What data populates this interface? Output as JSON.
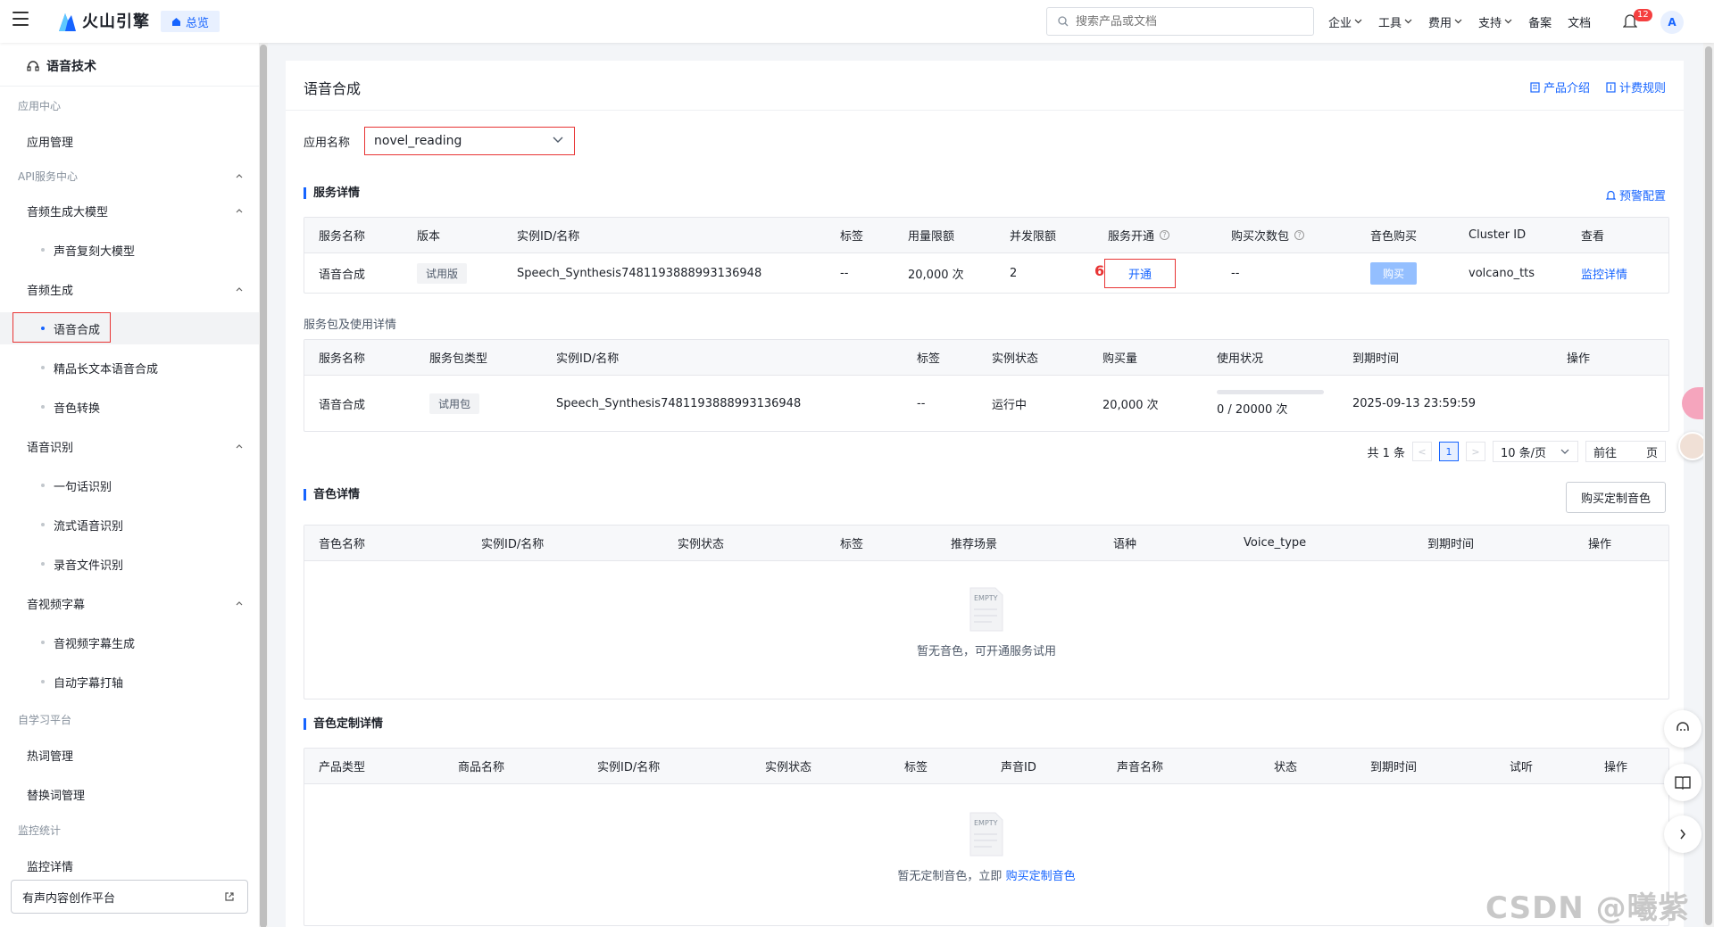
{
  "brand": {
    "logo_text": "火山引擎",
    "overview_tag": "总览"
  },
  "search": {
    "placeholder": "搜索产品或文档"
  },
  "topnav": [
    {
      "label": "企业",
      "has_dropdown": true
    },
    {
      "label": "工具",
      "has_dropdown": true
    },
    {
      "label": "费用",
      "has_dropdown": true
    },
    {
      "label": "支持",
      "has_dropdown": true
    },
    {
      "label": "备案",
      "has_dropdown": false
    },
    {
      "label": "文档",
      "has_dropdown": false
    }
  ],
  "notifications": {
    "count": "12"
  },
  "user": {
    "avatar_letter": "A"
  },
  "sidebar": {
    "title": "语音技术",
    "groups": {
      "app_center": "应用中心",
      "api_center": "API服务中心",
      "self_learning": "自学习平台",
      "monitoring": "监控统计"
    },
    "items": {
      "app_mgmt": "应用管理",
      "audio_gen_llm": "音频生成大模型",
      "voice_clone_llm": "声音复刻大模型",
      "audio_gen": "音频生成",
      "tts": "语音合成",
      "premium_long_tts": "精品长文本语音合成",
      "voice_conversion": "音色转换",
      "asr": "语音识别",
      "sentence_asr": "一句话识别",
      "streaming_asr": "流式语音识别",
      "file_asr": "录音文件识别",
      "av_subtitle": "音视频字幕",
      "av_subtitle_gen": "音视频字幕生成",
      "auto_subtitle_align": "自动字幕打轴",
      "hotword_mgmt": "热词管理",
      "replace_word_mgmt": "替换词管理",
      "monitor_detail": "监控详情"
    },
    "bottom_link": "有声内容创作平台"
  },
  "page": {
    "title": "语音合成",
    "links": {
      "product_intro": "产品介绍",
      "billing_rules": "计费规则"
    },
    "app_name_label": "应用名称",
    "app_name_value": "novel_reading"
  },
  "service_detail": {
    "title": "服务详情",
    "alert_config": "预警配置",
    "columns": [
      "服务名称",
      "版本",
      "实例ID/名称",
      "标签",
      "用量限额",
      "并发限额",
      "服务开通",
      "购买次数包",
      "音色购买",
      "Cluster ID",
      "查看"
    ],
    "row": {
      "service_name": "语音合成",
      "version": "试用版",
      "instance": "Speech_Synthesis7481193888993136948",
      "tag": "--",
      "usage_limit": "20,000 次",
      "concurrency": "2",
      "open_button": "开通",
      "step_marker": "6",
      "buy_packs": "--",
      "voice_buy_button": "购买",
      "cluster_id": "volcano_tts",
      "view_link": "监控详情"
    }
  },
  "package_detail": {
    "title": "服务包及使用详情",
    "columns": [
      "服务名称",
      "服务包类型",
      "实例ID/名称",
      "标签",
      "实例状态",
      "购买量",
      "使用状况",
      "到期时间",
      "操作"
    ],
    "row": {
      "service_name": "语音合成",
      "package_type": "试用包",
      "instance": "Speech_Synthesis7481193888993136948",
      "tag": "--",
      "status": "运行中",
      "amount": "20,000 次",
      "usage_text": "0 / 20000 次",
      "usage_fraction": 0,
      "expire": "2025-09-13 23:59:59"
    },
    "pagination": {
      "total": "共 1 条",
      "current_page": "1",
      "page_size": "10 条/页",
      "goto_label": "前往",
      "page_unit": "页"
    }
  },
  "voice_detail": {
    "title": "音色详情",
    "buy_custom_button": "购买定制音色",
    "columns": [
      "音色名称",
      "实例ID/名称",
      "实例状态",
      "标签",
      "推荐场景",
      "语种",
      "Voice_type",
      "到期时间",
      "操作"
    ],
    "empty_icon_text": "EMPTY",
    "empty_text": "暂无音色，可开通服务试用"
  },
  "custom_voice_detail": {
    "title": "音色定制详情",
    "columns": [
      "产品类型",
      "商品名称",
      "实例ID/名称",
      "实例状态",
      "标签",
      "声音ID",
      "声音名称",
      "状态",
      "到期时间",
      "试听",
      "操作"
    ],
    "empty_icon_text": "EMPTY",
    "empty_text": "暂无定制音色，立即",
    "empty_link": "购买定制音色"
  },
  "watermark": "CSDN @曦紫沐"
}
